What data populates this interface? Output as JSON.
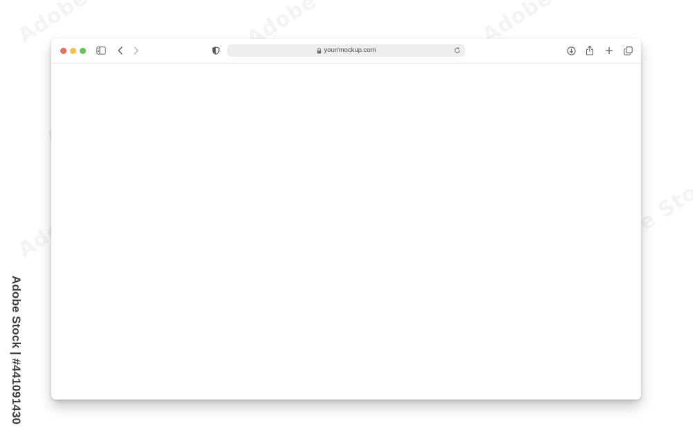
{
  "browser": {
    "url": "your/mockup.com",
    "icons": {
      "sidebar": "sidebar-icon",
      "back": "chevron-left-icon",
      "forward": "chevron-right-icon",
      "privacy": "shield-icon",
      "lock": "lock-icon",
      "reload": "reload-icon",
      "download": "download-icon",
      "share": "share-icon",
      "new_tab": "plus-icon",
      "tabs": "tab-overview-icon"
    },
    "traffic_colors": {
      "close": "#ec6a5e",
      "minimize": "#f4bf4f",
      "zoom": "#61c554"
    }
  },
  "overlay": {
    "watermark": "Adobe Stock",
    "stock_credit": "Adobe Stock | #441091430"
  }
}
